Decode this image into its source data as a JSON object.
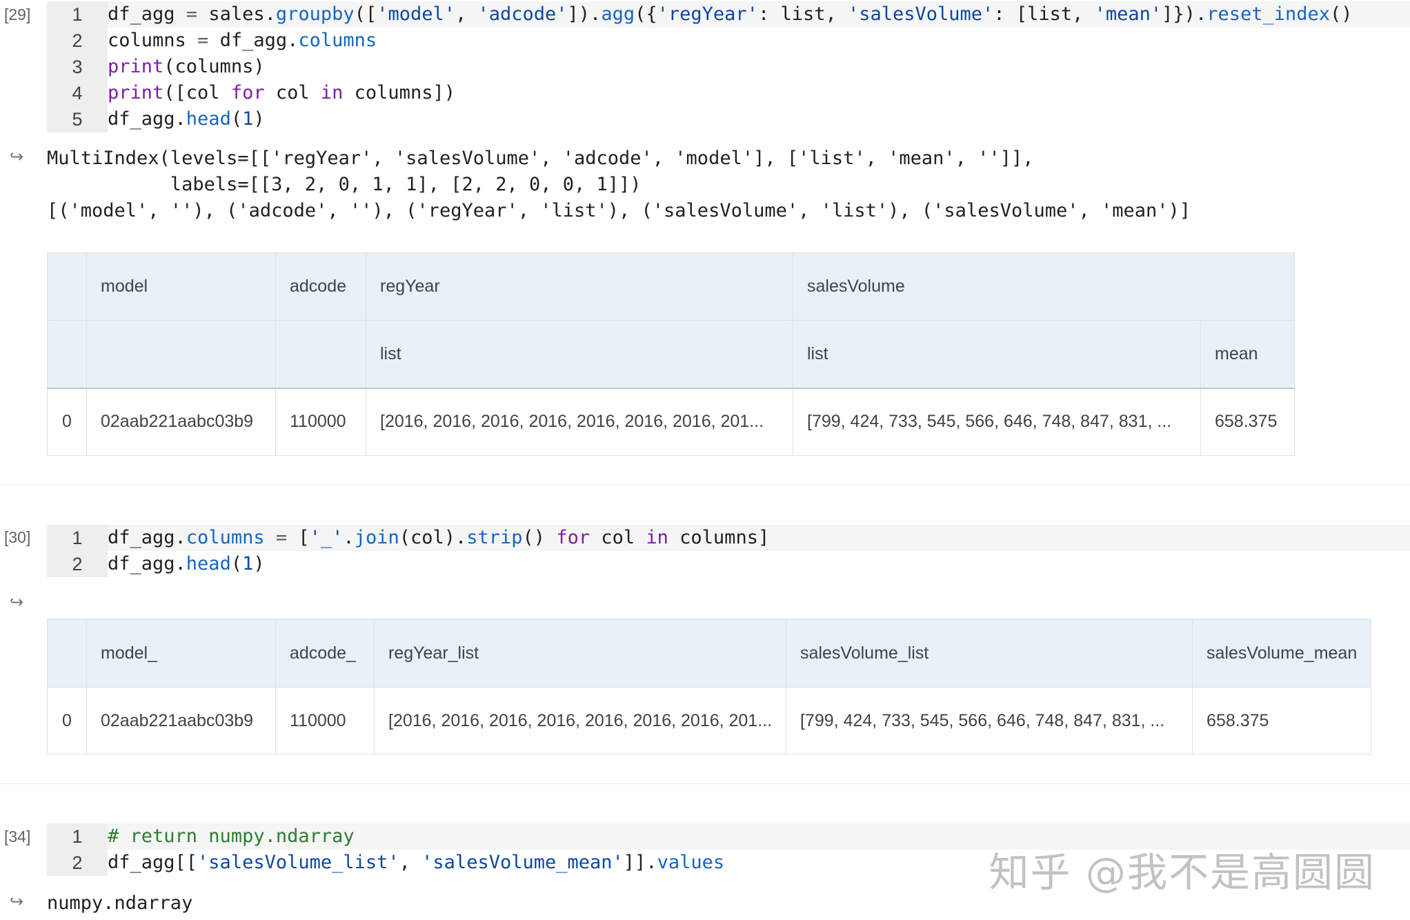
{
  "cells": [
    {
      "exec_count": "[29]",
      "code_lines": [
        {
          "no": "1"
        },
        {
          "no": "2"
        },
        {
          "no": "3"
        },
        {
          "no": "4"
        },
        {
          "no": "5"
        }
      ],
      "output_text": [
        "MultiIndex(levels=[['regYear', 'salesVolume', 'adcode', 'model'], ['list', 'mean', '']],",
        "           labels=[[3, 2, 0, 1, 1], [2, 2, 0, 0, 1]])",
        "[('model', ''), ('adcode', ''), ('regYear', 'list'), ('salesVolume', 'list'), ('salesVolume', 'mean')]"
      ],
      "table": {
        "header_top": [
          "",
          "model",
          "adcode",
          "regYear",
          "salesVolume"
        ],
        "header_sub": [
          "",
          "",
          "",
          "list",
          "list",
          "mean"
        ],
        "rows": [
          [
            "0",
            "02aab221aabc03b9",
            "110000",
            "[2016, 2016, 2016, 2016, 2016, 2016, 2016, 201...",
            "[799, 424, 733, 545, 566, 646, 748, 847, 831, ...",
            "658.375"
          ]
        ]
      }
    },
    {
      "exec_count": "[30]",
      "code_lines": [
        {
          "no": "1"
        },
        {
          "no": "2"
        }
      ],
      "table": {
        "headers": [
          "",
          "model_",
          "adcode_",
          "regYear_list",
          "salesVolume_list",
          "salesVolume_mean"
        ],
        "rows": [
          [
            "0",
            "02aab221aabc03b9",
            "110000",
            "[2016, 2016, 2016, 2016, 2016, 2016, 2016, 201...",
            "[799, 424, 733, 545, 566, 646, 748, 847, 831, ...",
            "658.375"
          ]
        ]
      }
    },
    {
      "exec_count": "[34]",
      "code_lines": [
        {
          "no": "1"
        },
        {
          "no": "2"
        }
      ],
      "output_text": [
        "numpy.ndarray"
      ]
    }
  ],
  "code": {
    "c29": {
      "l1": [
        "df_agg",
        " = ",
        "sales.",
        "groupby",
        "([",
        "'model'",
        ", ",
        "'adcode'",
        "]).",
        "agg",
        "({",
        "'regYear'",
        ": list, ",
        "'salesVolume'",
        ": [list, ",
        "'mean'",
        "]}).",
        "reset_index",
        "()"
      ],
      "l2": [
        "columns",
        " = ",
        "df_agg.",
        "columns"
      ],
      "l3": [
        "print",
        "(columns)"
      ],
      "l4": [
        "print",
        "([col ",
        "for",
        " col ",
        "in",
        " columns])"
      ],
      "l5": [
        "df_agg.",
        "head",
        "(",
        "1",
        ")"
      ]
    },
    "c30": {
      "l1": [
        "df_agg.",
        "columns",
        " = ",
        "[",
        "'_'",
        ".",
        "join",
        "(col).",
        "strip",
        "() ",
        "for",
        " col ",
        "in",
        " columns]"
      ],
      "l2": [
        "df_agg.",
        "head",
        "(",
        "1",
        ")"
      ]
    },
    "c34": {
      "l1": [
        "# return numpy.ndarray"
      ],
      "l2": [
        "df_agg[[",
        "'salesVolume_list'",
        ", ",
        "'salesVolume_mean'",
        "]].",
        "values"
      ]
    }
  },
  "output_icon": "output-arrow-icon",
  "watermark": "知乎 @我不是高圆圆"
}
